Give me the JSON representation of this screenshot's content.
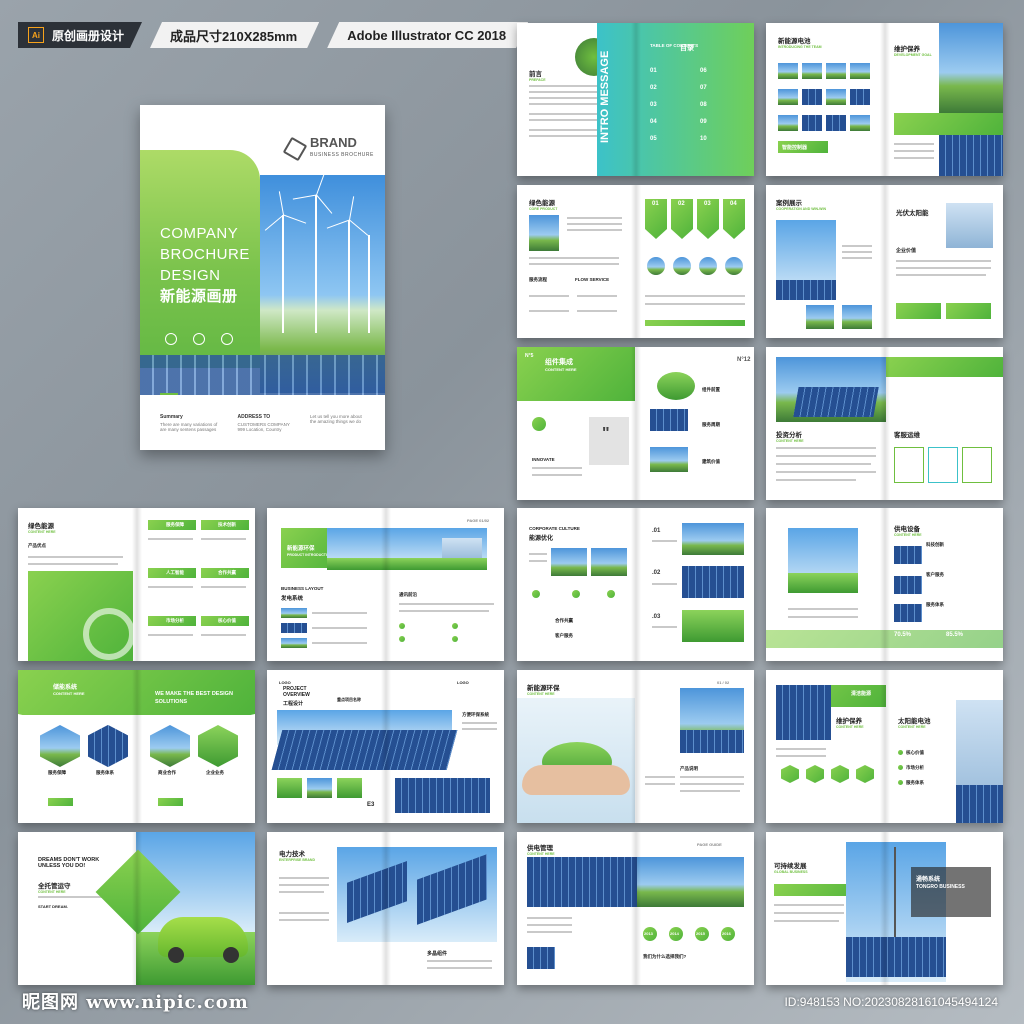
{
  "tags": {
    "ai_label": "Ai",
    "original": "原创画册设计",
    "size": "成品尺寸210X285mm",
    "software": "Adobe Illustrator CC 2018"
  },
  "cover": {
    "brand": "BRAND",
    "brand_sub": "BUSINESS BROCHURE",
    "title_lines": [
      "COMPANY",
      "BROCHURE",
      "DESIGN"
    ],
    "title_cn": "新能源画册",
    "foot": [
      {
        "head": "Summary",
        "text": "There are many variations of are many sentens passages"
      },
      {
        "head": "ADDRESS TO",
        "text": "CUSTOMERS COMPANY 999 Location, Country"
      },
      {
        "head": "",
        "text": "Let us tell you more about the amazing things we do"
      }
    ]
  },
  "spreads": {
    "s1": {
      "h1": "前言",
      "h1s": "PREFACE",
      "toc": "TABLE OF CONTENTS",
      "toc_cn": "目录",
      "side": "INTRO MESSAGE",
      "nums": [
        "01",
        "02",
        "03",
        "04",
        "05",
        "06",
        "07",
        "08",
        "09",
        "10"
      ]
    },
    "s2": {
      "h1": "新能源电池",
      "h1s": "INTRODUCING THE TEAM",
      "h2": "维护保养",
      "h2s": "DEVELOPMENT GOAL",
      "h3": "智能控制器"
    },
    "s3": {
      "h1": "绿色能源",
      "h1s": "CORE PRODUCT",
      "h2": "服务流程",
      "h3": "FLOW SERVICE",
      "nums": [
        "01",
        "02",
        "03",
        "04"
      ]
    },
    "s4": {
      "h1": "案例展示",
      "h1s": "COOPERATION AND WIN-WIN",
      "h2": "光伏太阳能",
      "h3": "企业价值"
    },
    "s5": {
      "h1": "组件集成",
      "h1s": "CONTENT HERE",
      "tag": "N°5",
      "num": "N°12",
      "h2": "组件前置",
      "h3": "服务周期",
      "h4": "建筑价值",
      "h5": "INNOVATE"
    },
    "s6": {
      "h1": "投资分析",
      "h1s": "CONTENT HERE",
      "h2": "客服运维"
    },
    "s7": {
      "h1": "绿色能源",
      "h1s": "CONTENT HERE",
      "h2": "产品优点",
      "items": [
        "服务保障",
        "技术创新",
        "人工智能",
        "合作共赢",
        "市场分析",
        "核心价值"
      ]
    },
    "s8": {
      "h1": "新能源环保",
      "h1s": "PRODUCT INTRODUCTION",
      "h2": "BUSINESS LAYOUT",
      "h3": "发电系统",
      "h4": "通讯前沿",
      "page": "PAGE 01/02"
    },
    "s9": {
      "h1": "CORPORATE CULTURE",
      "h2": "能源优化",
      "nums": [
        ".01",
        ".02",
        ".03"
      ],
      "h3": "合作共赢",
      "h4": "客户服务"
    },
    "s10": {
      "h1": "供电设备",
      "h1s": "CONTENT HERE",
      "h2": "科技创新",
      "h3": "客户服务",
      "h4": "服务体系",
      "p1": "70.5%",
      "p2": "85.5%"
    },
    "s11": {
      "h1": "储能系统",
      "h1s": "CONTENT HERE",
      "big": "WE MAKE THE BEST DESIGN SOLUTIONS",
      "labels": [
        "服务保障",
        "服务体系",
        "商业合作",
        "企业业务"
      ]
    },
    "s12": {
      "h1": "PROJECT OVERVIEW",
      "h1b": "工程设计",
      "logo": "LOGO",
      "h2": "重点项目名称",
      "h3": "方便环保系统",
      "tag": "E3"
    },
    "s13": {
      "h1": "新能源环保",
      "h1s": "CONTENT HERE",
      "h2": "产品说明",
      "page": "01 / 02"
    },
    "s14": {
      "h1": "维护保养",
      "h1s": "CONTENT HERE",
      "h2": "太阳能电池",
      "h2s": "CONTENT HERE",
      "h3": "清洁能源",
      "items": [
        "核心价值",
        "市场分析",
        "服务体系"
      ]
    },
    "s15": {
      "big1": "DREAMS DON'T WORK UNLESS YOU DO!",
      "h1": "全托管运守",
      "h1s": "CONTENT HERE",
      "h2": "START DREAM."
    },
    "s16": {
      "h1": "电力技术",
      "h1s": "ENTERPRISE BRAND",
      "h2": "多晶组件"
    },
    "s17": {
      "h1": "供电管理",
      "h1s": "CONTENT HERE",
      "page": "PAGE GUIDE",
      "years": [
        "2013",
        "2014",
        "2015",
        "2016"
      ],
      "h2": "我们为什么选择我们?"
    },
    "s18": {
      "h1": "可持续发展",
      "h1s": "GLOBAL BUSINESS",
      "h2": "通畅系统",
      "h2b": "TONGRO BUSINESS"
    }
  },
  "watermark": {
    "site": "昵图网 www.nipic.com",
    "id": "ID:948153 NO:20230828161045494124"
  }
}
